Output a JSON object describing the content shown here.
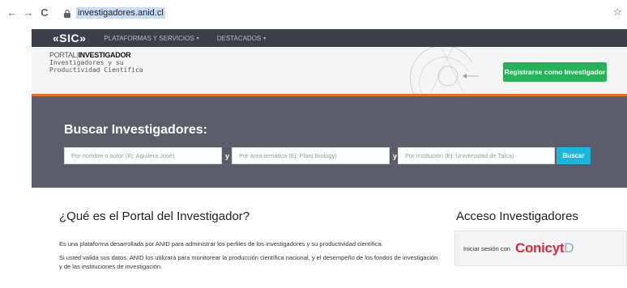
{
  "browser": {
    "url": "investigadores.anid.cl",
    "back_glyph": "←",
    "forward_glyph": "→",
    "reload_glyph": "C",
    "star_glyph": "☆"
  },
  "sic_bar": {
    "logo": "«SIC»",
    "menu": [
      "PLATAFORMAS Y SERVICIOS",
      "DESTACADOS"
    ],
    "caret": "▾"
  },
  "header": {
    "logo_line1_prefix": "PORTAL",
    "logo_line1_sep": "|",
    "logo_line1_bold": "INVESTIGADOR",
    "logo_line2": "Investigadores y su",
    "logo_line3": "Productividad Científica",
    "register_label": "Registrarse como Investigador"
  },
  "search": {
    "title": "Buscar Investigadores:",
    "author_placeholder": "Por nombre o autor (Ej: Aguilera José)",
    "area_placeholder": "Por área temática (Ej: Plant Biology)",
    "institution_placeholder": "Por institución (Ej: Universidad de Talca)",
    "y_label": "y",
    "button_label": "Buscar"
  },
  "about": {
    "title": "¿Qué es el Portal del Investigador?",
    "p1": "Es una plataforma desarrollada por ANID para administrar los perfiles de los investigadores y su productividad científica.",
    "p2": "Si usted valida sus datos, ANID los utilizará para monitorear la producción científica nacional, y el desempeño de los fondos de investigación y de las instituciones de investigación."
  },
  "access": {
    "title": "Acceso Investigadores",
    "login_text": "Iniciar sesión con",
    "brand_c": "C",
    "brand_o": "o",
    "brand_nicyt": "nicyt",
    "brand_d": "D"
  },
  "colors": {
    "sic_bar": "#3d4049",
    "header_line": "#e8702a",
    "register": "#26b259",
    "search_bg": "#5b5e6a",
    "search_button": "#1bb6d9",
    "conicyt": "#e0263a"
  }
}
